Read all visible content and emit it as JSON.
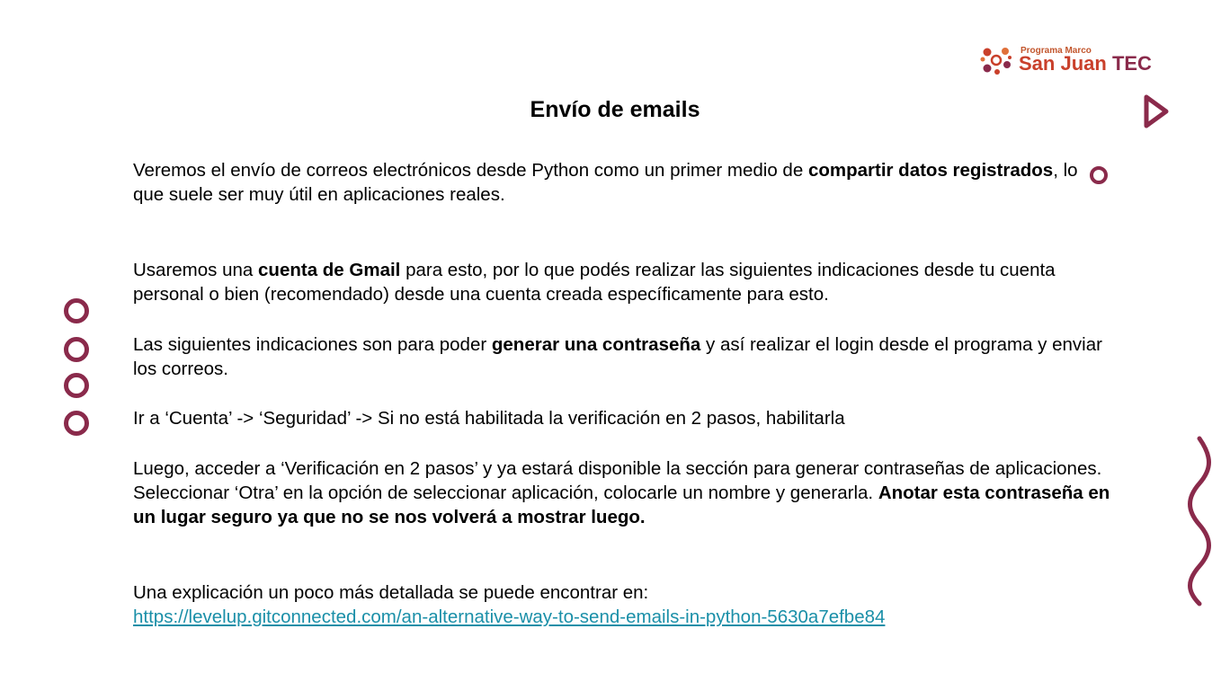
{
  "logo": {
    "small_text": "Programa Marco",
    "brand_main": "San Juan",
    "brand_suffix": "TEC"
  },
  "title": "Envío de emails",
  "paragraphs": {
    "p1": {
      "a": "Veremos el envío de correos electrónicos desde Python como un primer medio de ",
      "b_bold": "compartir datos registrados",
      "c": ", lo que suele ser muy útil en aplicaciones reales."
    },
    "p2": {
      "a": "Usaremos una ",
      "b_bold": "cuenta de Gmail",
      "c": " para esto, por lo que podés realizar las siguientes indicaciones desde tu cuenta personal o bien (recomendado) desde una cuenta creada específicamente para esto."
    },
    "p3": {
      "a": "Las siguientes indicaciones son para poder ",
      "b_bold": "generar una contraseña",
      "c": " y así realizar el login desde el programa y enviar los correos."
    },
    "p4": "Ir a ‘Cuenta’ -> ‘Seguridad’ -> Si no está habilitada la verificación en 2 pasos, habilitarla",
    "p5": {
      "a": "Luego, acceder a ‘Verificación en 2 pasos’ y ya estará disponible la sección para generar contraseñas de aplicaciones. Seleccionar ‘Otra’ en la opción de seleccionar aplicación, colocarle un nombre y generarla. ",
      "b_bold": "Anotar esta contraseña en un lugar seguro ya que no se nos volverá a mostrar luego."
    },
    "p6": {
      "intro": "Una explicación un poco más detallada se puede encontrar en:",
      "link": "https://levelup.gitconnected.com/an-alternative-way-to-send-emails-in-python-5630a7efbe84"
    }
  },
  "colors": {
    "accent": "#8a2a4b",
    "brand_orange": "#c9402b",
    "link": "#1a8fa8"
  },
  "decorations": [
    "play-triangle-icon",
    "small-circle-icon",
    "circle-column-icon",
    "wavy-line-icon"
  ]
}
